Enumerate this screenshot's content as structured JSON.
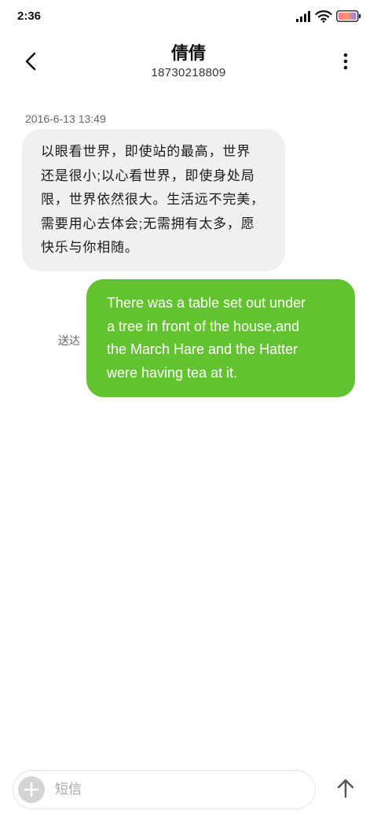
{
  "status_bar": {
    "time": "2:36",
    "icons": [
      "signal-icon",
      "wifi-icon",
      "battery-icon"
    ]
  },
  "header": {
    "title": "倩倩",
    "subtitle": "18730218809",
    "back_icon": "back-chevron-icon",
    "more_icon": "more-vertical-icon"
  },
  "conversation": {
    "timestamp": "2016-6-13 13:49",
    "received": {
      "text": "以眼看世界，即使站的最高，世界\n还是很小;以心看世界，即使身处局\n限，世界依然很大。生活远不完美，\n需要用心去体会;无需拥有太多，愿\n快乐与你相随。"
    },
    "sent": {
      "text": "There was a table set out under\na tree in front of the house,and\nthe March Hare and the Hatter\nwere having tea at it.",
      "status": "送达"
    }
  },
  "composer": {
    "placeholder": "短信",
    "add_icon": "plus-icon",
    "send_icon": "send-arrow-icon"
  },
  "colors": {
    "background": "#ffffff",
    "received_bubble": "#f0f0f0",
    "sent_bubble": "#63c22f",
    "sent_text": "#ffffff",
    "secondary_text": "#666666"
  }
}
